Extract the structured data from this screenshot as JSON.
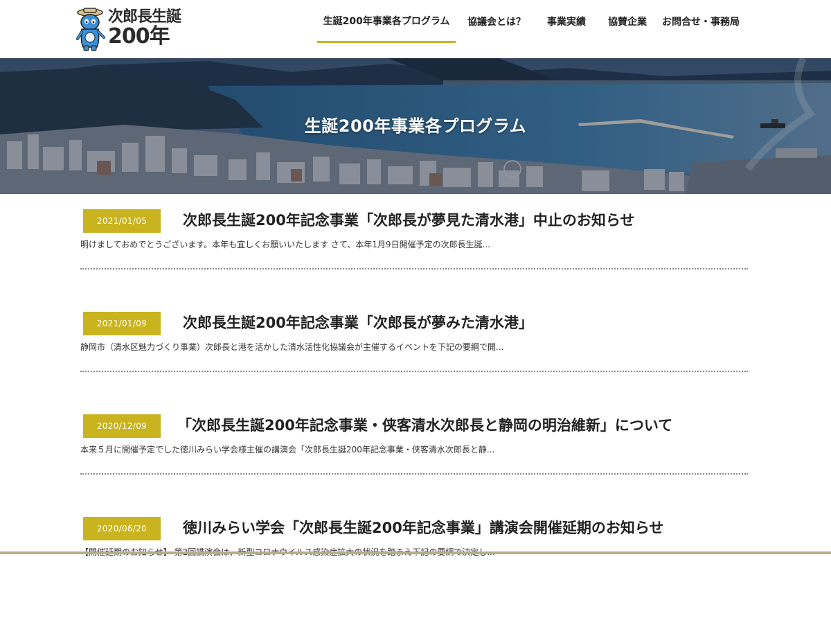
{
  "logo": {
    "line1": "次郎長生誕",
    "line2": "200年"
  },
  "nav": {
    "items": [
      "生誕200年事業各プログラム",
      "協議会とは？",
      "事業実績",
      "協賛企業",
      "お問合せ・事務局"
    ],
    "active_index": 0
  },
  "hero": {
    "title": "生誕200年事業各プログラム"
  },
  "posts": [
    {
      "date": "2021/01/05",
      "title": "次郎長生誕200年記念事業「次郎長が夢見た清水港」中止のお知らせ",
      "excerpt": "明けましておめでとうございます。本年も宜しくお願いいたします さて、本年1月9日開催予定の次郎長生誕..."
    },
    {
      "date": "2021/01/09",
      "title": "次郎長生誕200年記念事業「次郎長が夢みた清水港」",
      "excerpt": "静岡市（清水区魅力づくり事業）次郎長と港を活かした清水活性化協議会が主催するイベントを下記の要綱で開..."
    },
    {
      "date": "2020/12/09",
      "title": "「次郎長生誕200年記念事業・侠客清水次郎長と静岡の明治維新」について",
      "excerpt": "本来５月に開催予定でした徳川みらい学会様主催の講演会「次郎長生誕200年記念事業・侠客清水次郎長と静..."
    },
    {
      "date": "2020/06/20",
      "title": "徳川みらい学会「次郎長生誕200年記念事業」講演会開催延期のお知らせ",
      "excerpt": "【開催延期のお知らせ】 第2回講演会は、新型コロナウイルス感染症拡大の状況を踏まえ下記の要綱で決定し..."
    }
  ],
  "colors": {
    "accent": "#c9b31f",
    "mascot": "#3a8fd6",
    "text": "#222222"
  }
}
